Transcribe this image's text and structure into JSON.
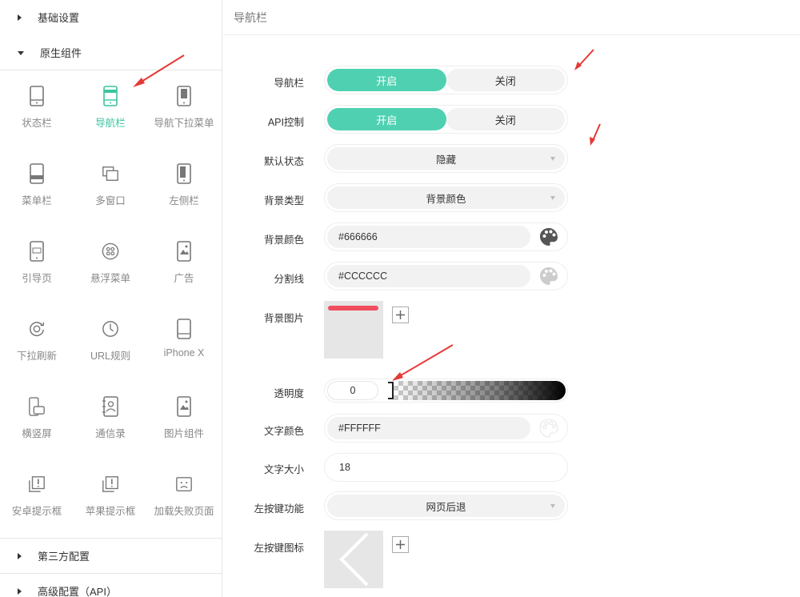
{
  "sidebar": {
    "sections": {
      "basic": "基础设置",
      "native": "原生组件",
      "third_party": "第三方配置",
      "advanced": "高级配置（API）"
    },
    "items": [
      {
        "label": "状态栏",
        "icon": "phone-icon"
      },
      {
        "label": "导航栏",
        "icon": "phone-navbar-icon",
        "active": true
      },
      {
        "label": "导航下拉菜单",
        "icon": "phone-dropdown-icon"
      },
      {
        "label": "菜单栏",
        "icon": "phone-menubar-icon"
      },
      {
        "label": "多窗口",
        "icon": "multi-window-icon"
      },
      {
        "label": "左侧栏",
        "icon": "phone-leftbar-icon"
      },
      {
        "label": "引导页",
        "icon": "guide-page-icon"
      },
      {
        "label": "悬浮菜单",
        "icon": "float-menu-icon"
      },
      {
        "label": "广告",
        "icon": "ad-icon"
      },
      {
        "label": "下拉刷新",
        "icon": "refresh-icon"
      },
      {
        "label": "URL规则",
        "icon": "clock-icon"
      },
      {
        "label": "iPhone X",
        "icon": "iphone-x-icon"
      },
      {
        "label": "横竖屏",
        "icon": "rotate-screen-icon"
      },
      {
        "label": "通信录",
        "icon": "contacts-icon"
      },
      {
        "label": "图片组件",
        "icon": "image-component-icon"
      },
      {
        "label": "安卓提示框",
        "icon": "android-alert-icon"
      },
      {
        "label": "苹果提示框",
        "icon": "ios-alert-icon"
      },
      {
        "label": "加载失败页面",
        "icon": "load-fail-icon"
      }
    ]
  },
  "main": {
    "title": "导航栏",
    "navbar": {
      "label": "导航栏",
      "on": "开启",
      "off": "关闭"
    },
    "api_control": {
      "label": "API控制",
      "on": "开启",
      "off": "关闭"
    },
    "default_state": {
      "label": "默认状态",
      "value": "隐藏"
    },
    "bg_type": {
      "label": "背景类型",
      "value": "背景颜色"
    },
    "bg_color": {
      "label": "背景颜色",
      "value": "#666666"
    },
    "divider": {
      "label": "分割线",
      "value": "#CCCCCC"
    },
    "bg_image": {
      "label": "背景图片"
    },
    "opacity": {
      "label": "透明度",
      "value": "0"
    },
    "text_color": {
      "label": "文字颜色",
      "value": "#FFFFFF"
    },
    "font_size": {
      "label": "文字大小",
      "value": "18"
    },
    "left_btn_func": {
      "label": "左按键功能",
      "value": "网页后退"
    },
    "left_btn_icon": {
      "label": "左按键图标"
    }
  },
  "colors": {
    "accent": "#4fd1b1",
    "arrow": "#e53935"
  }
}
